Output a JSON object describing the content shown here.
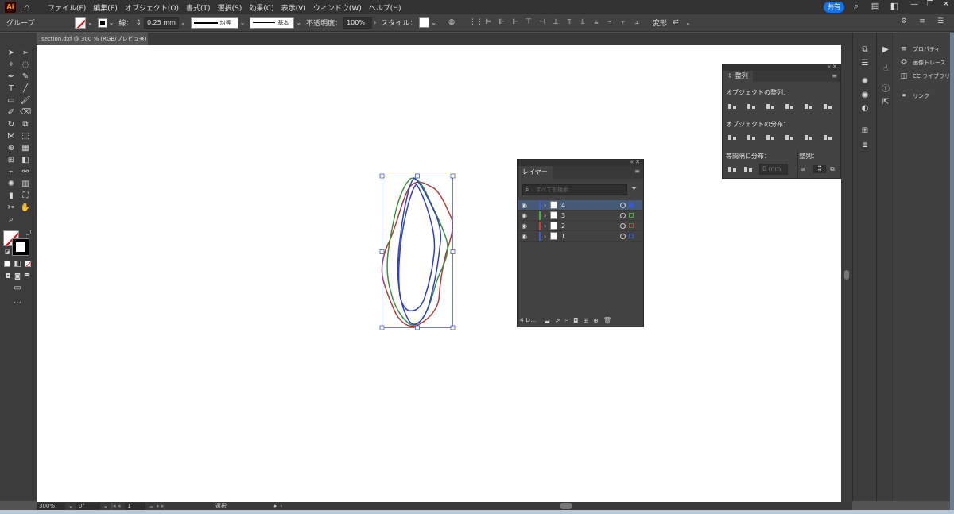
{
  "app": {
    "logo": "Ai",
    "home_icon": "home-icon"
  },
  "menu": [
    "ファイル(F)",
    "編集(E)",
    "オブジェクト(O)",
    "書式(T)",
    "選択(S)",
    "効果(C)",
    "表示(V)",
    "ウィンドウ(W)",
    "ヘルプ(H)"
  ],
  "share_label": "共有",
  "control": {
    "selection_type": "グループ",
    "stroke_label": "線：",
    "stroke_weight": "0.25 mm",
    "profile_label": "均等",
    "brush_label": "基本",
    "opacity_label": "不透明度：",
    "opacity_value": "100%",
    "style_label": "スタイル：",
    "transform_label": "変形"
  },
  "document_tab": {
    "title": "section.dxf @ 300 % (RGB/プレビュー)",
    "close": "×"
  },
  "status": {
    "zoom": "300%",
    "rotation": "0°",
    "artboard": "1",
    "tool": "選択"
  },
  "align_panel": {
    "tab": "整列",
    "align_objects": "オブジェクトの整列：",
    "distribute_objects": "オブジェクトの分布：",
    "distribute_spacing": "等間隔に分布：",
    "align_to": "整列：",
    "spacing_value": "0 mm"
  },
  "layers_panel": {
    "tab": "レイヤー",
    "search_placeholder": "すべてを検索",
    "footer_count": "4 レ...",
    "layers": [
      {
        "name": "4",
        "color": "#3b5bd6",
        "selected": true
      },
      {
        "name": "3",
        "color": "#3cb83c",
        "selected": false
      },
      {
        "name": "2",
        "color": "#d63b3b",
        "selected": false
      },
      {
        "name": "1",
        "color": "#3b5bd6",
        "selected": false
      }
    ]
  },
  "side_panel": {
    "properties": "プロパティ",
    "image_trace": "画像トレース",
    "libraries": "CC ライブラリ",
    "links": "リンク"
  }
}
